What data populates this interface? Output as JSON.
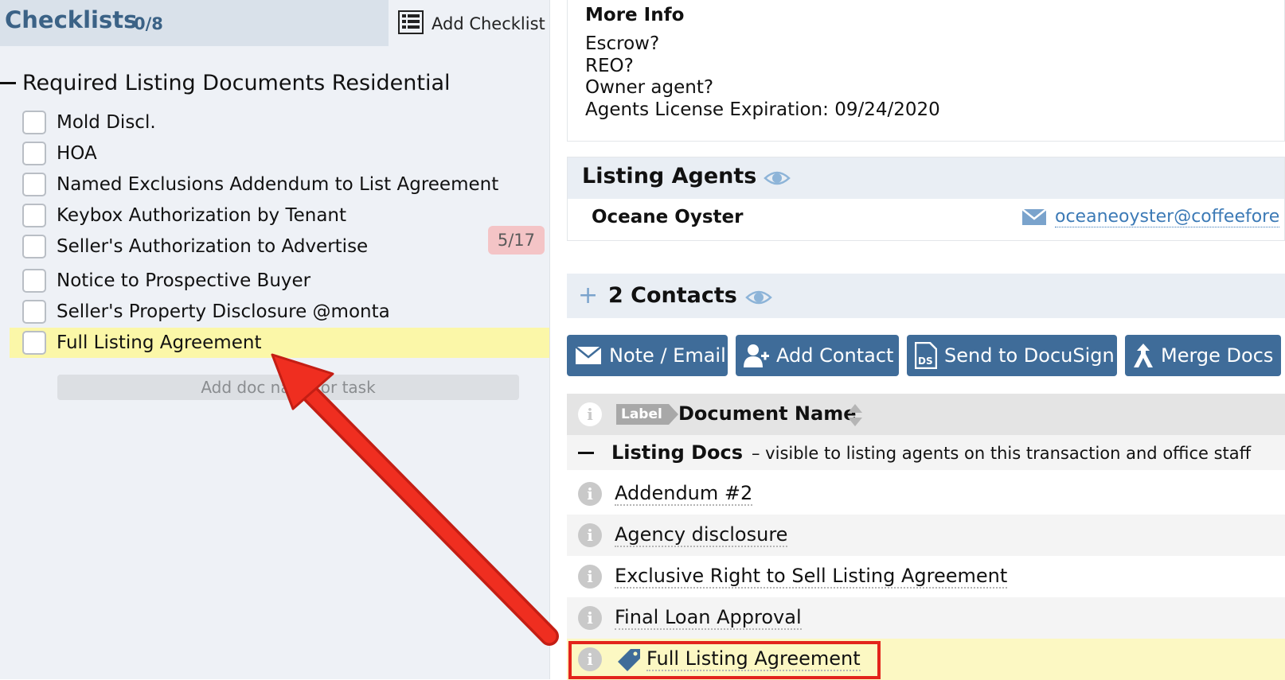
{
  "checklists": {
    "title": "Checklists",
    "count": "0/8",
    "add_label": "Add Checklist",
    "group_title": "Required Listing Documents Residential",
    "items": [
      {
        "label": "Mold Discl."
      },
      {
        "label": "HOA"
      },
      {
        "label": "Named Exclusions Addendum to List Agreement"
      },
      {
        "label": "Keybox Authorization by Tenant"
      },
      {
        "label": "Seller's Authorization to Advertise",
        "badge": "5/17"
      },
      {
        "label": "Notice to Prospective Buyer"
      },
      {
        "label": "Seller's Property Disclosure @monta"
      },
      {
        "label": "Full Listing Agreement",
        "highlighted": true
      }
    ],
    "add_doc_placeholder": "Add doc name or task"
  },
  "more_info": {
    "title": "More Info",
    "lines": [
      "Escrow?",
      "REO?",
      "Owner agent?",
      "Agents License Expiration: 09/24/2020"
    ]
  },
  "listing_agents": {
    "title": "Listing Agents",
    "agent_name": "Oceane Oyster",
    "agent_email": "oceaneoyster@coffeefore"
  },
  "contacts": {
    "title": "2 Contacts"
  },
  "actions": {
    "note_email": "Note / Email",
    "add_contact": "Add Contact",
    "send_docusign": "Send to DocuSign",
    "merge_docs": "Merge Docs"
  },
  "documents": {
    "label_tag": "Label",
    "column_name": "Document Name",
    "group_name": "Listing Docs",
    "group_desc": "– visible to listing agents on this transaction and office staff",
    "rows": [
      {
        "name": "Addendum #2"
      },
      {
        "name": "Agency disclosure"
      },
      {
        "name": "Exclusive Right to Sell Listing Agreement"
      },
      {
        "name": "Final Loan Approval"
      },
      {
        "name": "Full Listing Agreement",
        "tagged": true,
        "highlighted": true
      }
    ]
  },
  "colors": {
    "button_blue": "#3f6c99",
    "header_blue_text": "#3b6286",
    "highlight_yellow": "#fbf7a8",
    "annotation_red": "#e3241c",
    "link_blue": "#3c7ab6"
  }
}
